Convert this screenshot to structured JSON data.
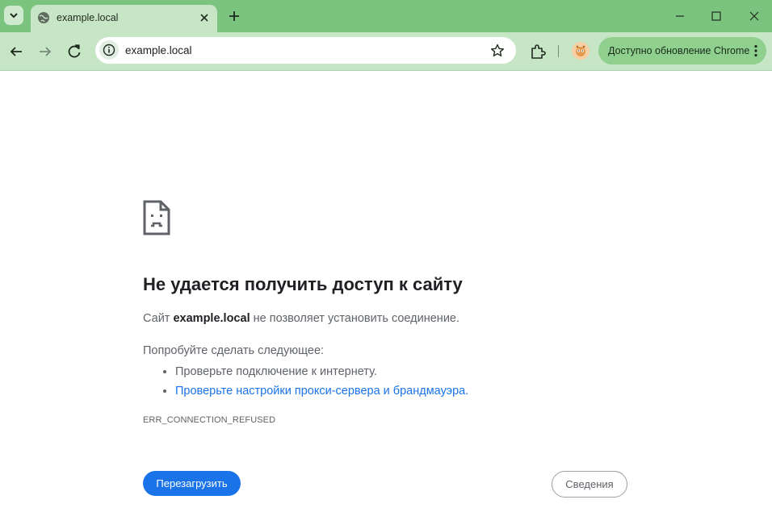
{
  "browser": {
    "tab": {
      "title": "example.local",
      "favicon": "globe-icon"
    },
    "url": "example.local",
    "update_label": "Доступно обновление Chrome",
    "accent_color": "#7bc47f"
  },
  "error": {
    "title": "Не удается получить доступ к сайту",
    "desc_prefix": "Сайт",
    "desc_host": "example.local",
    "desc_suffix": "не позволяет установить соединение.",
    "try_heading": "Попробуйте сделать следующее:",
    "suggestions": [
      "Проверьте подключение к интернету.",
      "Проверьте настройки прокси-сервера и брандмауэра."
    ],
    "code": "ERR_CONNECTION_REFUSED",
    "reload_label": "Перезагрузить",
    "details_label": "Сведения"
  }
}
